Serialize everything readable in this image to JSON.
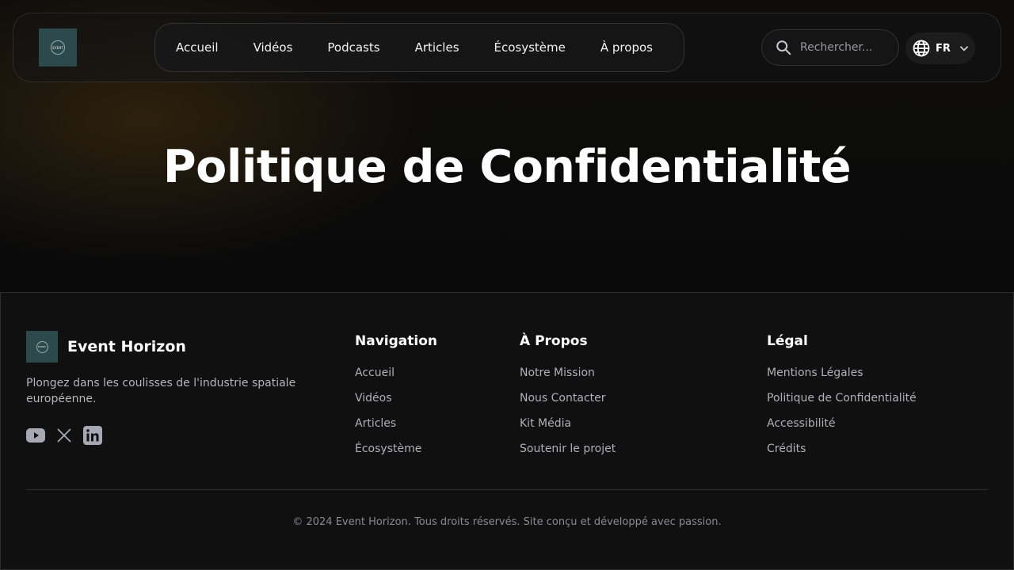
{
  "header": {
    "logo_text": "EVENT",
    "nav": [
      "Accueil",
      "Vidéos",
      "Podcasts",
      "Articles",
      "Écosystème",
      "À propos"
    ],
    "search_placeholder": "Rechercher...",
    "language": "FR"
  },
  "hero": {
    "title": "Politique de Confidentialité"
  },
  "footer": {
    "brand": "Event Horizon",
    "logo_text": "EVENT",
    "tagline": "Plongez dans les coulisses de l'industrie spatiale européenne.",
    "social_icons": [
      "youtube-icon",
      "x-icon",
      "linkedin-icon"
    ],
    "columns": [
      {
        "title": "Navigation",
        "links": [
          "Accueil",
          "Vidéos",
          "Articles",
          "Écosystème"
        ]
      },
      {
        "title": "À Propos",
        "links": [
          "Notre Mission",
          "Nous Contacter",
          "Kit Média",
          "Soutenir le projet"
        ]
      },
      {
        "title": "Légal",
        "links": [
          "Mentions Légales",
          "Politique de Confidentialité",
          "Accessibilité",
          "Crédits"
        ]
      }
    ],
    "copyright": "© 2024 Event Horizon. Tous droits réservés. Site conçu et développé avec passion."
  },
  "colors": {
    "background": "#0b0b0d",
    "logo_bg": "#2c4a4b",
    "text_primary": "#ffffff",
    "text_muted": "#b0b0b5"
  }
}
